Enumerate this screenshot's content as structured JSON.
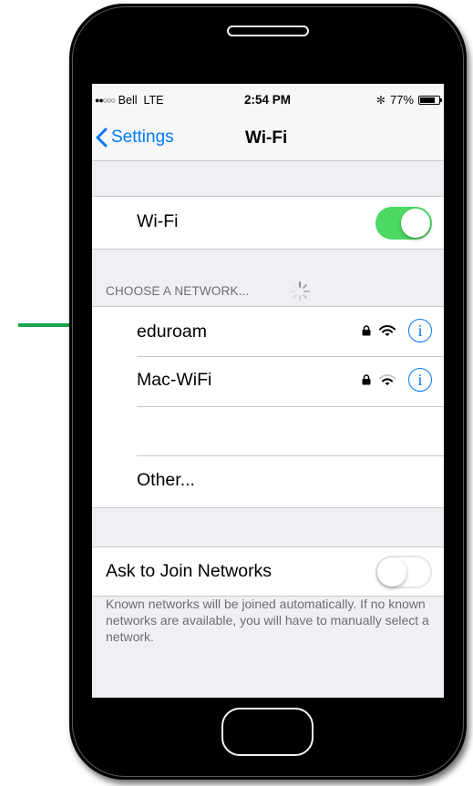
{
  "status": {
    "carrier_dots": "●●○○○",
    "carrier": "Bell  LTE",
    "time": "2:54 PM",
    "bluetooth": "✻",
    "battery_percent": "77%"
  },
  "nav": {
    "back_label": "Settings",
    "title": "Wi-Fi"
  },
  "wifi": {
    "label": "Wi-Fi",
    "enabled": true
  },
  "networks": {
    "section_header": "CHOOSE A NETWORK...",
    "items": [
      {
        "name": "eduroam",
        "secured": true,
        "signal": "full"
      },
      {
        "name": "Mac-WiFi",
        "secured": true,
        "signal": "medium"
      }
    ],
    "other_label": "Other..."
  },
  "ask_join": {
    "label": "Ask to Join Networks",
    "enabled": false,
    "footer": "Known networks will be joined automatically. If no known networks are available, you will have to manually select a network."
  },
  "colors": {
    "accent": "#007aff",
    "toggle_on": "#4cd964",
    "arrow": "#17a44b"
  }
}
